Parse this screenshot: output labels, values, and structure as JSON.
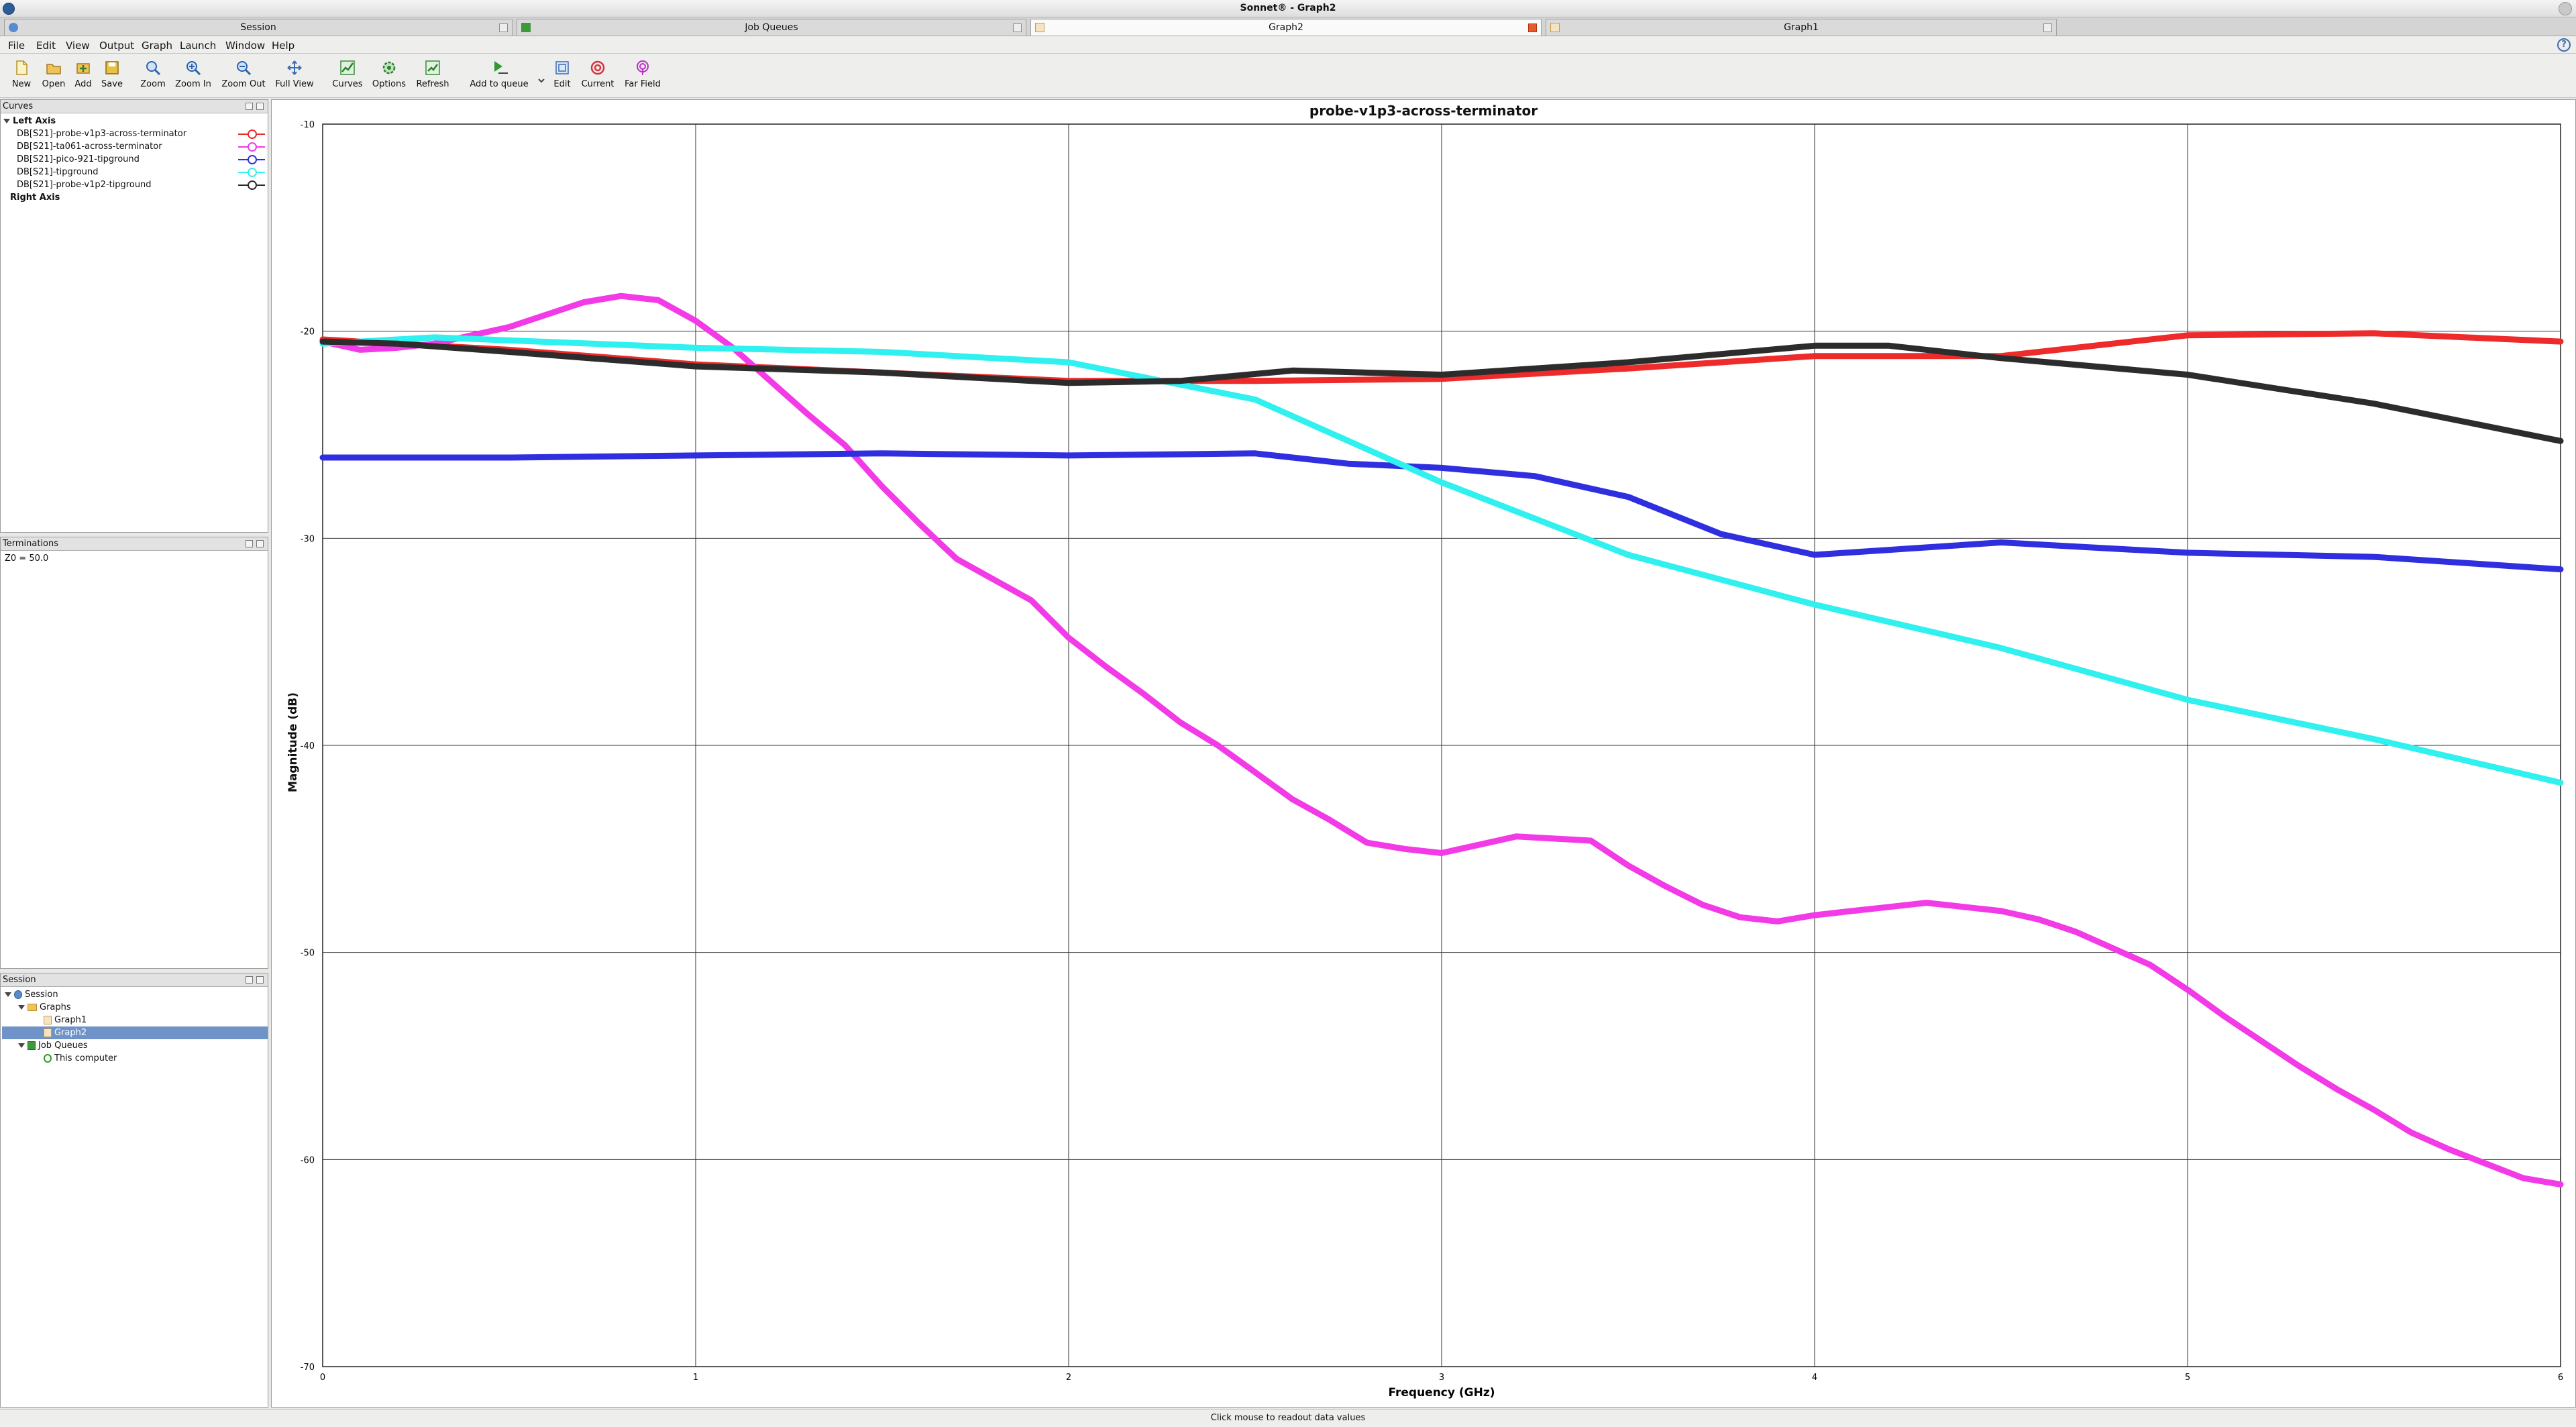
{
  "window": {
    "title": "Sonnet® - Graph2"
  },
  "tabs": [
    {
      "label": "Session",
      "active": false
    },
    {
      "label": "Job Queues",
      "active": false
    },
    {
      "label": "Graph2",
      "active": true
    },
    {
      "label": "Graph1",
      "active": false
    }
  ],
  "menu": [
    "File",
    "Edit",
    "View",
    "Output",
    "Graph",
    "Launch",
    "Window",
    "Help"
  ],
  "help_glyph": "?",
  "toolbar": {
    "new": "New",
    "open": "Open",
    "add": "Add",
    "save": "Save",
    "zoom": "Zoom",
    "zoom_in": "Zoom In",
    "zoom_out": "Zoom Out",
    "full_view": "Full View",
    "curves": "Curves",
    "options": "Options",
    "refresh": "Refresh",
    "add_to_queue": "Add to queue",
    "edit": "Edit",
    "current": "Current",
    "far_field": "Far Field"
  },
  "curves_panel": {
    "title": "Curves",
    "left_axis": "Left Axis",
    "right_axis": "Right Axis",
    "items": [
      {
        "label": "DB[S21]-probe-v1p3-across-terminator",
        "color": "#ee2b2b"
      },
      {
        "label": "DB[S21]-ta061-across-terminator",
        "color": "#f23ae6"
      },
      {
        "label": "DB[S21]-pico-921-tipground",
        "color": "#2f2fe0"
      },
      {
        "label": "DB[S21]-tipground",
        "color": "#30f0f0"
      },
      {
        "label": "DB[S21]-probe-v1p2-tipground",
        "color": "#2c2c2c"
      }
    ]
  },
  "terminations_panel": {
    "title": "Terminations",
    "value": "Z0 = 50.0"
  },
  "session_panel": {
    "title": "Session",
    "root": "Session",
    "graphs": "Graphs",
    "graph1": "Graph1",
    "graph2": "Graph2",
    "job_queues": "Job Queues",
    "computer": "This computer"
  },
  "status": "Click mouse to readout data values",
  "chart_data": {
    "type": "line",
    "title": "probe-v1p3-across-terminator",
    "xlabel": "Frequency (GHz)",
    "ylabel": "Magnitude (dB)",
    "xlim": [
      0,
      6
    ],
    "ylim": [
      -70,
      -10
    ],
    "xticks": [
      "0",
      "1",
      "2",
      "3",
      "4",
      "5",
      "6"
    ],
    "yticks": [
      "-10",
      "-20",
      "-30",
      "-40",
      "-50",
      "-60",
      "-70"
    ],
    "grid": true,
    "series": [
      {
        "name": "DB[S21]-probe-v1p3-across-terminator",
        "color": "#ee2b2b",
        "x": [
          0,
          0.5,
          1,
          1.5,
          2,
          2.5,
          3,
          3.5,
          4,
          4.5,
          5,
          5.5,
          6
        ],
        "y": [
          -20.4,
          -20.9,
          -21.6,
          -22.0,
          -22.4,
          -22.4,
          -22.3,
          -21.8,
          -21.2,
          -21.2,
          -20.2,
          -20.1,
          -20.5
        ]
      },
      {
        "name": "DB[S21]-ta061-across-terminator",
        "color": "#f23ae6",
        "x": [
          0,
          0.1,
          0.2,
          0.3,
          0.4,
          0.5,
          0.6,
          0.7,
          0.8,
          0.9,
          1.0,
          1.1,
          1.2,
          1.3,
          1.4,
          1.5,
          1.6,
          1.7,
          1.8,
          1.9,
          2.0,
          2.1,
          2.2,
          2.3,
          2.4,
          2.5,
          2.6,
          2.7,
          2.8,
          2.9,
          3.0,
          3.1,
          3.2,
          3.3,
          3.4,
          3.5,
          3.6,
          3.7,
          3.8,
          3.9,
          4.0,
          4.1,
          4.2,
          4.3,
          4.4,
          4.5,
          4.6,
          4.7,
          4.8,
          4.9,
          5.0,
          5.1,
          5.2,
          5.3,
          5.4,
          5.5,
          5.6,
          5.7,
          5.8,
          5.9,
          6.0
        ],
        "y": [
          -20.5,
          -20.9,
          -20.8,
          -20.6,
          -20.2,
          -19.8,
          -19.2,
          -18.6,
          -18.3,
          -18.5,
          -19.5,
          -20.8,
          -22.4,
          -24.0,
          -25.5,
          -27.5,
          -29.3,
          -31.0,
          -32.0,
          -33.0,
          -34.8,
          -36.2,
          -37.5,
          -38.9,
          -40.0,
          -41.3,
          -42.6,
          -43.6,
          -44.7,
          -45.0,
          -45.2,
          -44.8,
          -44.4,
          -44.5,
          -44.6,
          -45.8,
          -46.8,
          -47.7,
          -48.3,
          -48.5,
          -48.2,
          -48.0,
          -47.8,
          -47.6,
          -47.8,
          -48.0,
          -48.4,
          -49.0,
          -49.8,
          -50.6,
          -51.8,
          -53.1,
          -54.3,
          -55.5,
          -56.6,
          -57.6,
          -58.7,
          -59.5,
          -60.2,
          -60.9,
          -61.2
        ]
      },
      {
        "name": "DB[S21]-pico-921-tipground",
        "color": "#2f2fe0",
        "x": [
          0,
          0.3,
          0.5,
          1.0,
          1.5,
          2.0,
          2.5,
          2.75,
          3.0,
          3.25,
          3.5,
          3.75,
          4.0,
          4.25,
          4.5,
          5.0,
          5.5,
          6.0
        ],
        "y": [
          -26.1,
          -26.1,
          -26.1,
          -26.0,
          -25.9,
          -26.0,
          -25.9,
          -26.4,
          -26.6,
          -27.0,
          -28.0,
          -29.8,
          -30.8,
          -30.5,
          -30.2,
          -30.7,
          -30.9,
          -31.5
        ]
      },
      {
        "name": "DB[S21]-tipground",
        "color": "#30f0f0",
        "x": [
          0,
          0.3,
          1.0,
          1.5,
          2.0,
          2.5,
          3.0,
          3.5,
          4.0,
          4.5,
          5.0,
          5.5,
          6.0
        ],
        "y": [
          -20.6,
          -20.3,
          -20.8,
          -21.0,
          -21.5,
          -23.3,
          -27.3,
          -30.8,
          -33.2,
          -35.3,
          -37.8,
          -39.7,
          -41.8
        ]
      },
      {
        "name": "DB[S21]-probe-v1p2-tipground",
        "color": "#2c2c2c",
        "x": [
          0,
          0.2,
          0.5,
          1.0,
          1.5,
          2.0,
          2.3,
          2.6,
          3.0,
          3.5,
          4.0,
          4.2,
          4.5,
          5.0,
          5.5,
          6.0
        ],
        "y": [
          -20.5,
          -20.6,
          -21.0,
          -21.7,
          -22.0,
          -22.5,
          -22.4,
          -21.9,
          -22.1,
          -21.5,
          -20.7,
          -20.7,
          -21.3,
          -22.1,
          -23.5,
          -25.3
        ]
      }
    ]
  }
}
